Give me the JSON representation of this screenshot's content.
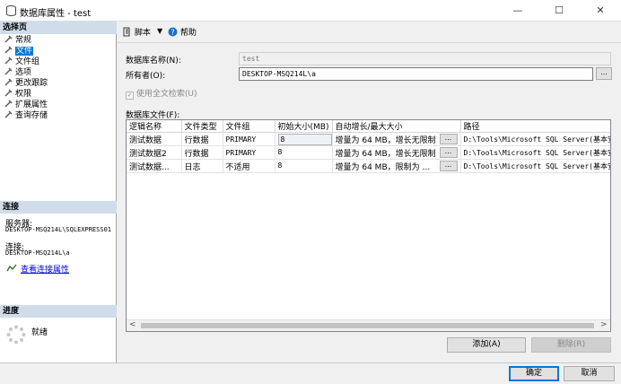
{
  "window": {
    "title": "数据库属性 - test",
    "minimize": "—",
    "maximize": "☐",
    "close": "✕"
  },
  "left": {
    "select_page_header": "选择页",
    "nav_items": [
      {
        "label": "常规"
      },
      {
        "label": "文件"
      },
      {
        "label": "文件组"
      },
      {
        "label": "选项"
      },
      {
        "label": "更改跟踪"
      },
      {
        "label": "权限"
      },
      {
        "label": "扩展属性"
      },
      {
        "label": "查询存储"
      }
    ],
    "connection_header": "连接",
    "server_label": "服务器:",
    "server_value": "DESKTOP-MSQ214L\\SQLEXPRESS01",
    "connection_label": "连接:",
    "connection_value": "DESKTOP-MSQ214L\\a",
    "view_connection_props": "查看连接属性",
    "progress_header": "进度",
    "progress_status": "就绪"
  },
  "toolbar": {
    "script": "脚本",
    "help": "帮助"
  },
  "form": {
    "db_name_label": "数据库名称(N):",
    "db_name_value": "test",
    "owner_label": "所有者(O):",
    "owner_value": "DESKTOP-MSQ214L\\a",
    "owner_btn": "...",
    "fulltext_label": "使用全文检索(U)",
    "files_label": "数据库文件(F):"
  },
  "grid": {
    "headers": [
      "逻辑名称",
      "文件类型",
      "文件组",
      "初始大小(MB)",
      "自动增长/最大大小",
      "路径"
    ],
    "rows": [
      {
        "name": "测试数据",
        "type": "行数据",
        "group": "PRIMARY",
        "size": "8",
        "growth": "增量为 64 MB，增长无限制",
        "path": "D:\\Tools\\Microsoft SQL Server(基本安装"
      },
      {
        "name": "测试数据2",
        "type": "行数据",
        "group": "PRIMARY",
        "size": "8",
        "growth": "增量为 64 MB，增长无限制",
        "path": "D:\\Tools\\Microsoft SQL Server(基本安装"
      },
      {
        "name": "测试数据...",
        "type": "日志",
        "group": "不适用",
        "size": "8",
        "growth": "增量为 64 MB，限制为 ...",
        "path": "D:\\Tools\\Microsoft SQL Server(基本安装"
      }
    ],
    "ellipsis": "...",
    "scroll_left": "<",
    "scroll_right": ">"
  },
  "buttons": {
    "add": "添加(A)",
    "remove": "删除(R)",
    "ok": "确定",
    "cancel": "取消"
  },
  "colors": {
    "accent": "#0078d7",
    "section_header": "#cfdcea"
  }
}
